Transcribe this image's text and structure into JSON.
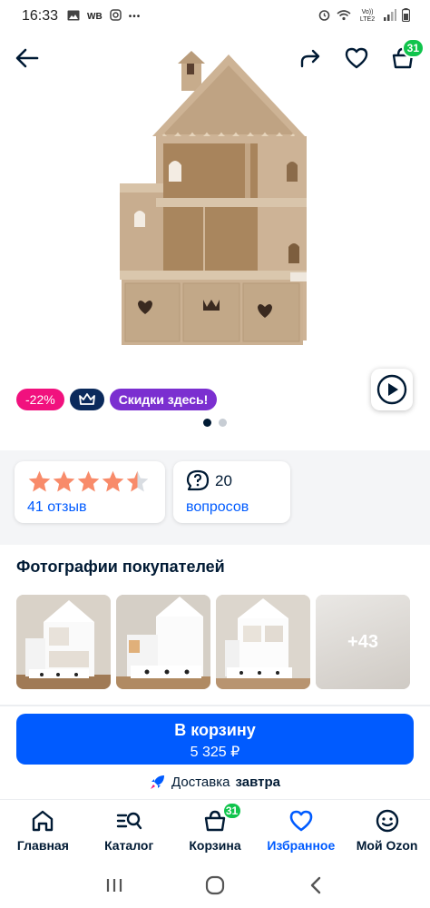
{
  "status_bar": {
    "time": "16:33",
    "left_icons": [
      "image-icon",
      "wb-icon",
      "instagram-icon",
      "more-dots-icon"
    ],
    "wb_text": "WB",
    "more_text": "•••",
    "right_icons": [
      "alarm-icon",
      "wifi-icon",
      "lte-icon",
      "signal-icon",
      "battery-icon"
    ],
    "network_text": "Vo)) LTE2"
  },
  "header": {
    "cart_count": "31"
  },
  "gallery": {
    "badges": {
      "discount": "-22%",
      "sale": "Скидки здесь!"
    },
    "dots_total": 2,
    "dots_active": 0
  },
  "rating_card": {
    "stars": 4.5,
    "reviews_label": "41 отзыв"
  },
  "questions_card": {
    "count": "20",
    "label": "вопросов"
  },
  "photos": {
    "title": "Фотографии покупателей",
    "more_label": "+43"
  },
  "buy": {
    "title": "В корзину",
    "price": "5 325 ₽"
  },
  "delivery": {
    "label": "Доставка",
    "when": "завтра"
  },
  "tabbar": {
    "items": [
      {
        "label": "Главная",
        "icon": "home-icon"
      },
      {
        "label": "Каталог",
        "icon": "catalog-search-icon"
      },
      {
        "label": "Корзина",
        "icon": "cart-icon",
        "badge": "31"
      },
      {
        "label": "Избранное",
        "icon": "heart-icon",
        "active": true
      },
      {
        "label": "Мой Ozon",
        "icon": "smile-icon"
      }
    ]
  },
  "colors": {
    "accent": "#005bff",
    "discount": "#f1117e",
    "premium": "#0b2a5c",
    "sale": "#7b2fd0",
    "badge_green": "#10c44c",
    "star": "#f88b6a"
  }
}
